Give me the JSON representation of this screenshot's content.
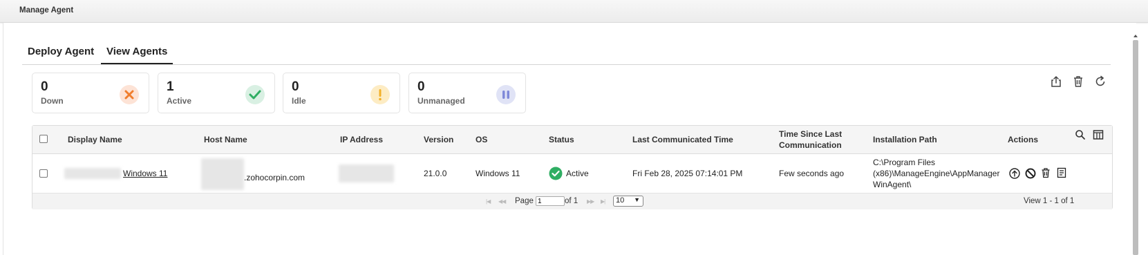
{
  "window": {
    "title": "Manage Agent"
  },
  "tabs": [
    {
      "label": "Deploy Agent",
      "active": false
    },
    {
      "label": "View Agents",
      "active": true
    }
  ],
  "summary_cards": [
    {
      "count": "0",
      "label": "Down",
      "icon": "x-icon",
      "color": "#f07e2e"
    },
    {
      "count": "1",
      "label": "Active",
      "icon": "check-icon",
      "color": "#2fae63"
    },
    {
      "count": "0",
      "label": "Idle",
      "icon": "exclamation-icon",
      "color": "#f3b12a"
    },
    {
      "count": "0",
      "label": "Unmanaged",
      "icon": "pause-icon",
      "color": "#7f89d9"
    }
  ],
  "toolbar_icons": [
    "export-icon",
    "delete-icon",
    "refresh-icon"
  ],
  "table": {
    "columns": [
      "Display Name",
      "Host Name",
      "IP Address",
      "Version",
      "OS",
      "Status",
      "Last Communicated Time",
      "Time Since Last Communication",
      "Installation Path",
      "Actions"
    ],
    "header_icons": [
      "search-icon",
      "columns-icon"
    ],
    "rows": [
      {
        "display_name": "Windows 11",
        "host_name": ".zohocorpin.com",
        "ip_address": "",
        "version": "21.0.0",
        "os": "Windows 11",
        "status": "Active",
        "status_icon": "check-circle-icon",
        "last_communicated": "Fri Feb 28, 2025 07:14:01 PM",
        "time_since": "Few seconds ago",
        "install_path_lines": [
          "C:\\Program Files",
          "(x86)\\ManageEngine\\AppManager",
          "WinAgent\\"
        ],
        "actions": [
          "upgrade-icon",
          "disable-icon",
          "delete-icon",
          "log-icon"
        ]
      }
    ]
  },
  "pagination": {
    "page_label": "Page",
    "page_value": "1",
    "of_label": "of 1",
    "page_size": "10",
    "view_label": "View 1 - 1 of 1"
  }
}
